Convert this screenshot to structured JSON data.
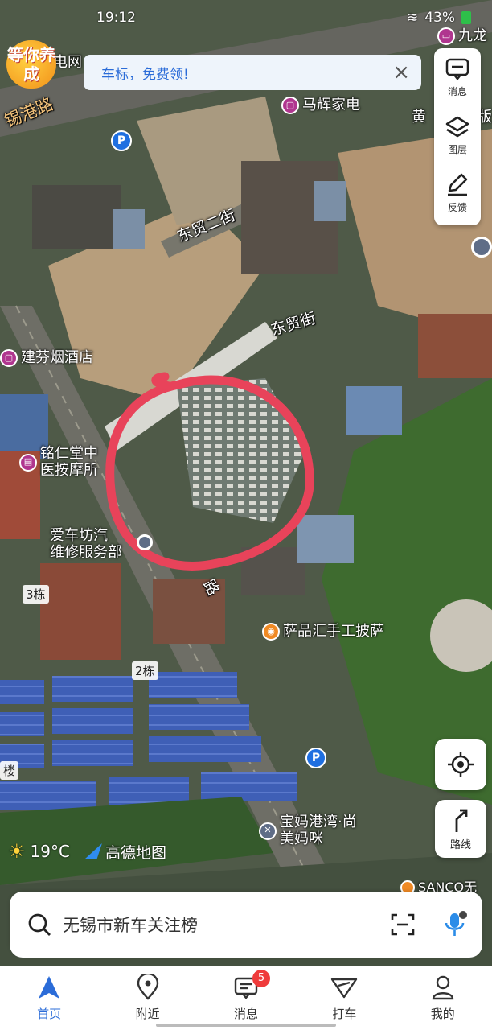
{
  "status_bar": {
    "time": "19:12",
    "battery": "43%"
  },
  "promo": {
    "badge": "等你养成",
    "banner_text": "车标，免费领!",
    "close": "×"
  },
  "map": {
    "roads": {
      "xigang": "锡港路",
      "dongmao2": "东贸二街",
      "dongmao": "东贸街",
      "partial_road": "路"
    },
    "pois": {
      "jiulong": "九龙",
      "dianwang": "电网",
      "mahui": "马辉家电",
      "huang": "黄",
      "ban": "版",
      "jianfen": "建芬烟酒店",
      "mingren_1": "铭仁堂中",
      "mingren_2": "医按摩所",
      "aichefang_1": "爱车坊汽",
      "aichefang_2": "维修服务部",
      "sapinhui": "萨品汇手工披萨",
      "baoma_1": "宝妈港湾·尚",
      "baoma_2": "美妈咪",
      "sanco": "SANCO无"
    },
    "buildings": {
      "b3": "3栋",
      "b2": "2栋",
      "edge": "楼"
    },
    "parking": "P"
  },
  "tools": [
    {
      "label": "消息",
      "icon": "message-icon"
    },
    {
      "label": "图层",
      "icon": "layers-icon"
    },
    {
      "label": "反馈",
      "icon": "feedback-icon"
    }
  ],
  "route": {
    "label": "路线"
  },
  "weather": {
    "temp": "19°C",
    "brand": "高德地图"
  },
  "search": {
    "query": "无锡市新车关注榜"
  },
  "nav": [
    {
      "label": "首页",
      "active": true
    },
    {
      "label": "附近"
    },
    {
      "label": "消息",
      "badge": "5"
    },
    {
      "label": "打车"
    },
    {
      "label": "我的"
    }
  ],
  "colors": {
    "accent": "#2b6cd8",
    "badge": "#ef3b3b",
    "annotation_circle": "#e8435a"
  }
}
